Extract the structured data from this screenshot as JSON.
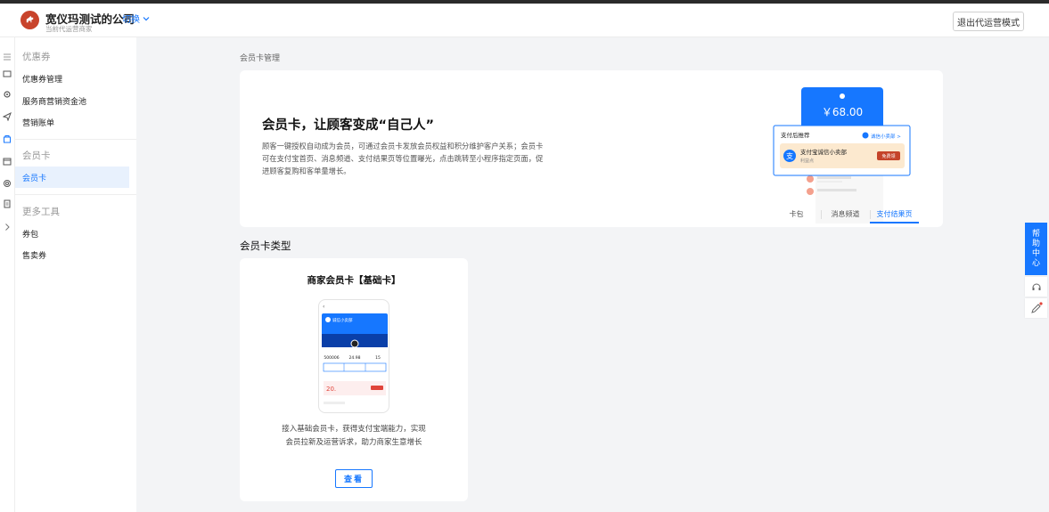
{
  "header": {
    "company": "宽仪玛测试的公司",
    "subtitle": "当前代运营商家",
    "switch_label": "切换",
    "exit_button": "退出代运营模式"
  },
  "sidebar": {
    "groups": [
      {
        "title": "优惠券",
        "items": [
          "优惠券管理",
          "服务商营销资金池",
          "营销账单"
        ]
      },
      {
        "title": "会员卡",
        "items": [
          "会员卡"
        ]
      },
      {
        "title": "更多工具",
        "items": [
          "券包",
          "售卖券"
        ]
      }
    ],
    "active_item": "会员卡"
  },
  "breadcrumb": "会员卡管理",
  "banner": {
    "title": "会员卡，让顾客变成“自己人”",
    "description": "顾客一键授权自动成为会员，可通过会员卡发放会员权益和积分维护客户关系；会员卡可在支付宝首页、消息频道、支付结果页等位置曝光，点击跳转至小程序指定页面，促进顾客复购和客单量增长。",
    "illustration": {
      "amount": "￥68.00",
      "panel_title": "支付后推荐",
      "panel_link": "诚信小卖部 >",
      "shop_name": "支付宝诚信小卖部",
      "shop_sub": "利益点",
      "badge": "免费领"
    },
    "tabs": [
      "卡包",
      "消息频道",
      "支付结果页"
    ],
    "active_tab": "支付结果页"
  },
  "section_title": "会员卡类型",
  "card": {
    "title": "商家会员卡【基础卡】",
    "phone": {
      "shop": "诚信小卖部",
      "stats_values": [
        "500006",
        "24.98",
        "15"
      ],
      "coupon_value": "20."
    },
    "description_line1": "接入基础会员卡，获得支付宝端能力，实现",
    "description_line2": "会员拉新及运营诉求，助力商家生意增长",
    "button": "查看"
  },
  "help": {
    "chars": [
      "帮",
      "助",
      "中",
      "心"
    ]
  },
  "colors": {
    "accent": "#1677ff",
    "avatar": "#c8432b"
  }
}
